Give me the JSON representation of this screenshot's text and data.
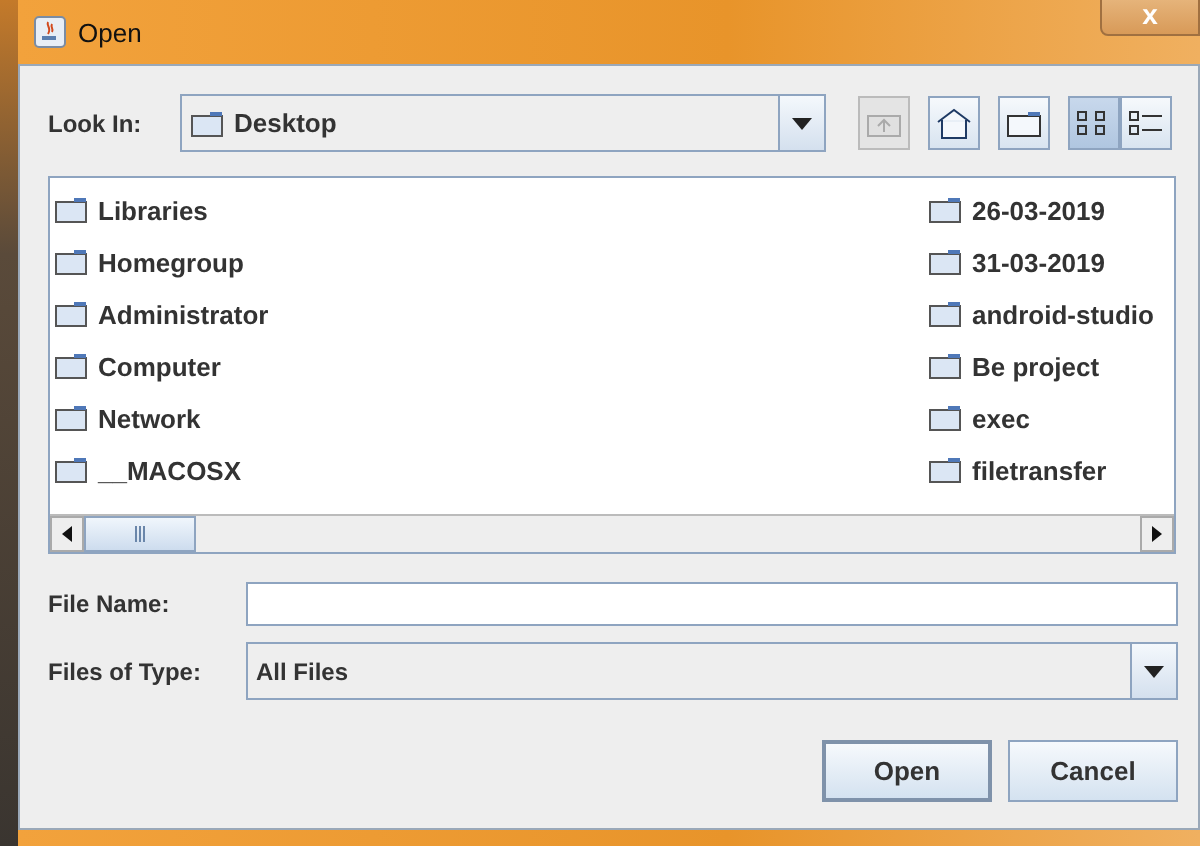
{
  "window": {
    "title": "Open",
    "close_glyph": "x"
  },
  "look_in": {
    "label": "Look In:",
    "value": "Desktop"
  },
  "toolbar": [
    {
      "kind": "up",
      "disabled": true,
      "selected": false
    },
    {
      "kind": "home",
      "disabled": false,
      "selected": false
    },
    {
      "kind": "newfolder",
      "disabled": false,
      "selected": false
    },
    {
      "kind": "list",
      "disabled": false,
      "selected": true
    },
    {
      "kind": "details",
      "disabled": false,
      "selected": false
    }
  ],
  "files": {
    "columns": [
      [
        "Libraries",
        "Homegroup",
        "Administrator",
        "Computer",
        "Network",
        "__MACOSX"
      ],
      [
        "26-03-2019",
        "31-03-2019",
        "android-studio",
        "Be project",
        "exec",
        "filetransfer"
      ]
    ]
  },
  "file_name": {
    "label": "File Name:"
  },
  "file_type": {
    "label": "Files of Type:",
    "value": "All Files"
  },
  "buttons": [
    "Open",
    "Cancel"
  ]
}
